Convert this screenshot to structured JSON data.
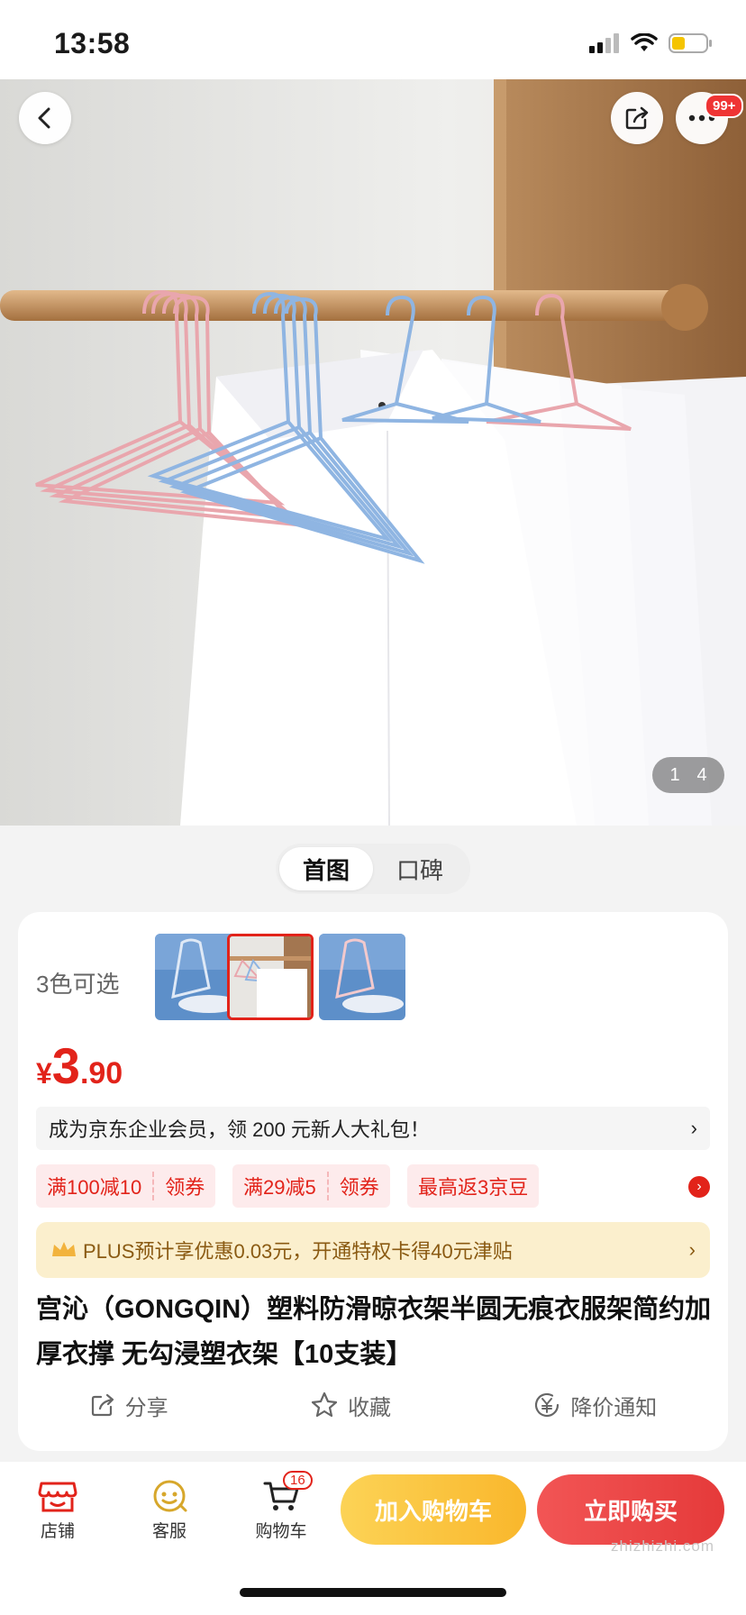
{
  "status": {
    "time": "13:58"
  },
  "nav": {
    "more_badge": "99+"
  },
  "gallery": {
    "current": "1",
    "total": "4"
  },
  "view_toggle": {
    "tabs": [
      "首图",
      "口碑"
    ]
  },
  "product": {
    "color_count_label": "3色可选",
    "price": {
      "currency": "¥",
      "integer": "3",
      "decimal": ".90"
    },
    "promo_text": "成为京东企业会员，领 200 元新人大礼包！",
    "promo_arrow": "›",
    "coupons": [
      {
        "label": "满100减10",
        "action": "领券"
      },
      {
        "label": "满29减5",
        "action": "领券"
      },
      {
        "label": "最高返3京豆"
      }
    ],
    "plus_text": "PLUS预计享优惠0.03元，开通特权卡得40元津贴",
    "plus_arrow": "›",
    "title": "宫沁（GONGQIN）塑料防滑晾衣架半圆无痕衣服架简约加厚衣撑 无勾浸塑衣架【10支装】",
    "actions": {
      "share": "分享",
      "favorite": "收藏",
      "price_alert": "降价通知"
    }
  },
  "bottom": {
    "shop": "店铺",
    "service": "客服",
    "cart": "购物车",
    "cart_badge": "16",
    "add_to_cart": "加入购物车",
    "buy_now": "立即购买"
  },
  "watermark": "zhizhizhi.com",
  "colors": {
    "jd_red": "#e2231a",
    "plus_bg": "#fbefcd",
    "cart_btn": "#f9b72c"
  }
}
